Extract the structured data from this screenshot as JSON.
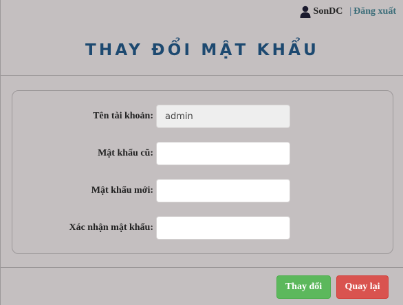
{
  "header": {
    "username": "SonDC",
    "separator": "|",
    "logout_label": "Đăng xuất",
    "user_icon": "user-icon"
  },
  "page": {
    "title": "THAY ĐỔI MẬT KHẨU"
  },
  "form": {
    "username_label": "Tên tài khoản:",
    "username_value": "admin",
    "old_password_label": "Mật khẩu cũ:",
    "old_password_value": "",
    "new_password_label": "Mật khẩu mới:",
    "new_password_value": "",
    "confirm_password_label": "Xác nhận mật khẩu:",
    "confirm_password_value": ""
  },
  "actions": {
    "save_label": "Thay đổi",
    "back_label": "Quay lại",
    "save_color": "#5cb85c",
    "back_color": "#d9534f"
  },
  "colors": {
    "background": "#c4bfc0",
    "title": "#1d4970"
  }
}
